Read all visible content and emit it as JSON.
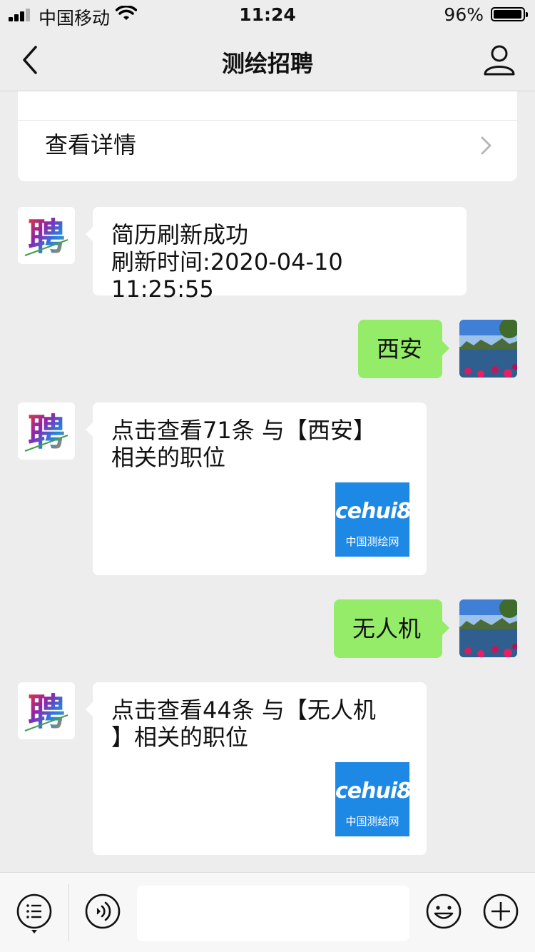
{
  "status_bar": {
    "carrier": "中国移动",
    "time": "11:24",
    "battery_percent": "96%",
    "battery_level": 0.96,
    "signal_bars": 3,
    "icons": [
      "signal-icon",
      "wifi-icon",
      "battery-icon"
    ]
  },
  "nav": {
    "title": "测绘招聘",
    "back_icon": "chevron-left-icon",
    "profile_icon": "person-icon"
  },
  "top_card": {
    "link_label": "查看详情",
    "chevron_icon": "chevron-right-icon"
  },
  "messages": [
    {
      "side": "in",
      "lines": [
        "简历刷新成功",
        "刷新时间:2020-04-10 11:25:55"
      ]
    },
    {
      "side": "out",
      "text": "西安"
    },
    {
      "side": "in",
      "lines": [
        "点击查看71条 与【西安】",
        "相关的职位"
      ],
      "logo": {
        "brand": "cehui8",
        "sub": "中国测绘网"
      }
    },
    {
      "side": "out",
      "text": "无人机"
    },
    {
      "side": "in",
      "lines": [
        "点击查看44条 与【无人机",
        "】相关的职位"
      ],
      "logo": {
        "brand": "cehui8",
        "sub": "中国测绘网"
      }
    }
  ],
  "bot_avatar_glyph": "聘",
  "toolbar": {
    "menu_icon": "menu-list-icon",
    "voice_icon": "voice-icon",
    "input_value": "",
    "emoji_icon": "smiley-icon",
    "plus_icon": "plus-circle-icon"
  },
  "colors": {
    "background": "#ededed",
    "bubble_out": "#95ec69",
    "bubble_in": "#ffffff",
    "logo_blue": "#1e88e5"
  }
}
